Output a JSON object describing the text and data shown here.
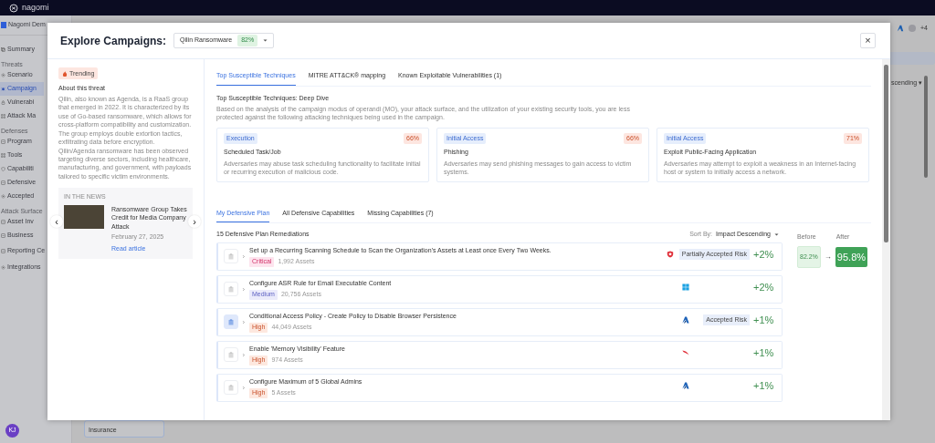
{
  "app": {
    "logo": "nagomi",
    "org": "Nagomi Dem",
    "avatar": "KJ",
    "header_count": "+4",
    "sort_fragment": "scending ▾",
    "list_item": "Insurance",
    "sidebar": [
      {
        "kind": "item",
        "label": "Summary",
        "selected": false
      },
      {
        "kind": "section",
        "label": "Threats"
      },
      {
        "kind": "item",
        "label": "Scenario",
        "selected": false
      },
      {
        "kind": "item",
        "label": "Campaign",
        "selected": true
      },
      {
        "kind": "item",
        "label": "Vulnerabi",
        "selected": false
      },
      {
        "kind": "item",
        "label": "Attack Ma",
        "selected": false
      },
      {
        "kind": "section",
        "label": "Defenses"
      },
      {
        "kind": "item",
        "label": "Program",
        "selected": false
      },
      {
        "kind": "item",
        "label": "Tools",
        "selected": false
      },
      {
        "kind": "item",
        "label": "Capabiliti",
        "selected": false
      },
      {
        "kind": "item",
        "label": "Defensive",
        "selected": false
      },
      {
        "kind": "item",
        "label": "Accepted",
        "selected": false
      },
      {
        "kind": "section",
        "label": "Attack Surface"
      },
      {
        "kind": "item",
        "label": "Asset Inv",
        "selected": false
      },
      {
        "kind": "item",
        "label": "Business",
        "selected": false
      },
      {
        "kind": "top",
        "label": "Reporting Ce",
        "selected": false
      },
      {
        "kind": "top",
        "label": "Integrations",
        "selected": false
      }
    ]
  },
  "modal": {
    "title": "Explore Campaigns:",
    "campaign": {
      "value": "Qilin Ransomware",
      "score": "82%"
    },
    "close": "×",
    "threat": {
      "trending": "Trending",
      "about_title": "About this threat",
      "about_text": "Qilin, also known as Agenda, is a RaaS group that emerged in 2022. It is characterized by its use of Go-based ransomware, which allows for cross-platform compatibility and customization. The group employs double extortion tactics, exfiltrating data before encryption. Qilin/Agenda ransomware has been observed targeting diverse sectors, including healthcare, manufacturing, and government, with payloads tailored to specific victim environments.",
      "news": {
        "heading": "IN THE NEWS",
        "title": "Ransomware Group Takes Credit for Media Company Attack",
        "date": "February 27, 2025",
        "link": "Read article",
        "prev": "‹",
        "next": "›"
      }
    },
    "tabs": [
      {
        "label": "Top Susceptible Techniques",
        "selected": true
      },
      {
        "label": "MITRE ATT&CK® mapping",
        "selected": false
      },
      {
        "label": "Known Exploitable Vulnerabilities (1)",
        "selected": false
      }
    ],
    "deep_dive": {
      "title": "Top Susceptible Techniques: Deep Dive",
      "description": "Based on the analysis of the campaign modus of operandi (MO), your attack surface, and the utilization of your existing security tools, you are less protected against the following attacking techniques being used in the campaign."
    },
    "techniques": [
      {
        "tactic": "Execution",
        "score": "66%",
        "name": "Scheduled Task/Job",
        "description": "Adversaries may abuse task scheduling functionality to facilitate initial or recurring execution of malicious code."
      },
      {
        "tactic": "Initial Access",
        "score": "66%",
        "name": "Phishing",
        "description": "Adversaries may send phishing messages to gain access to victim systems."
      },
      {
        "tactic": "Initial Access",
        "score": "71%",
        "name": "Exploit Public-Facing Application",
        "description": "Adversaries may attempt to exploit a weakness in an Internet-facing host or system to initially access a network."
      }
    ],
    "plan_tabs": [
      {
        "label": "My Defensive Plan",
        "selected": true
      },
      {
        "label": "All Defensive Capabilities",
        "selected": false
      },
      {
        "label": "Missing Capabilities (7)",
        "selected": false
      }
    ],
    "plan_count": "15 Defensive Plan Remediations",
    "sort": {
      "label": "Sort By:",
      "value": "Impact Descending"
    },
    "remediations": [
      {
        "title": "Set up a Recurring Scanning Schedule to Scan the Organization's Assets at Least once Every Two Weeks.",
        "severity": "Critical",
        "kind": "critical",
        "assets": "1,992 Assets",
        "tag": "Partially Accepted Risk",
        "impact": "+2%",
        "selected": false
      },
      {
        "title": "Configure ASR Rule for Email Executable Content",
        "severity": "Medium",
        "kind": "medium",
        "assets": "20,756 Assets",
        "impact": "+2%",
        "selected": false
      },
      {
        "title": "Conditional Access Policy - Create Policy to Disable Browser Persistence",
        "severity": "High",
        "kind": "high",
        "assets": "44,049 Assets",
        "tag": "Accepted Risk",
        "impact": "+1%",
        "selected": true
      },
      {
        "title": "Enable 'Memory Visibility' Feature",
        "severity": "High",
        "kind": "high",
        "assets": "974 Assets",
        "impact": "+1%",
        "selected": false
      },
      {
        "title": "Configure Maximum of 5 Global Admins",
        "severity": "High",
        "kind": "high",
        "assets": "5 Assets",
        "impact": "+1%",
        "selected": false
      }
    ],
    "before": {
      "label": "Before",
      "value": "82.2%"
    },
    "after": {
      "label": "After",
      "value": "95.8%"
    },
    "arrow": "→"
  }
}
